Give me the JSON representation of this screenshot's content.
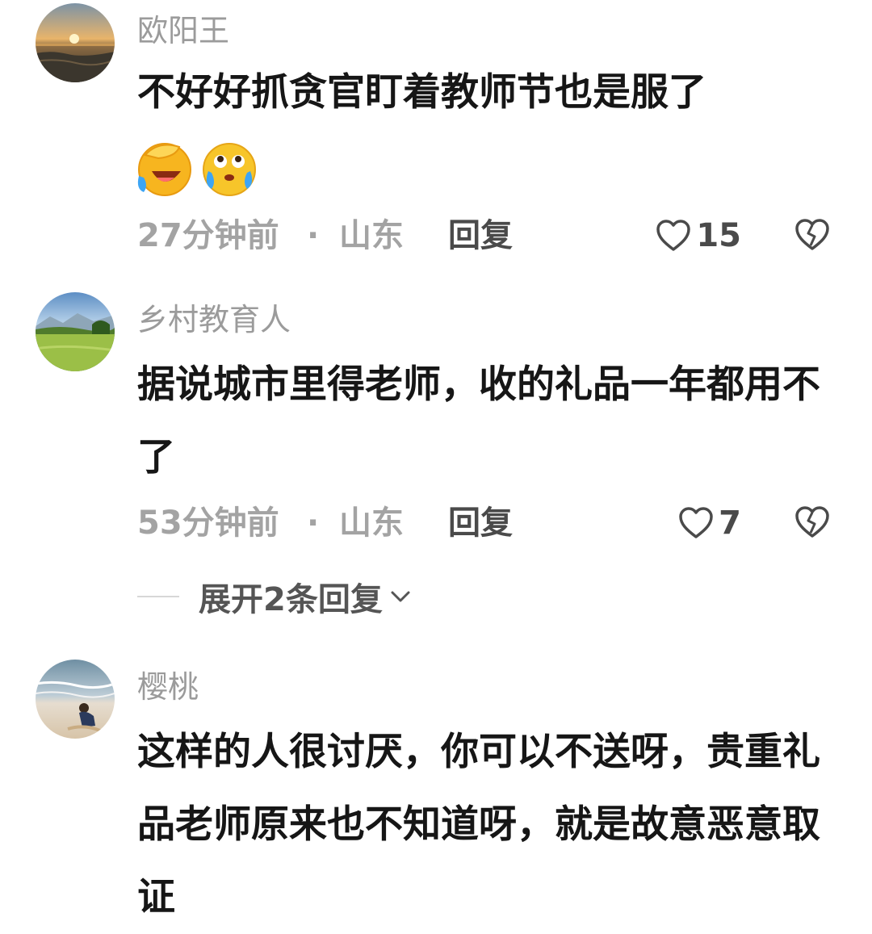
{
  "comments": [
    {
      "username": "欧阳王",
      "text": "不好好抓贪官盯着教师节也是服了",
      "emojis": [
        "cover-face-laugh-cry-emoji",
        "look-up-tears-emoji"
      ],
      "time": "27分钟前",
      "dot": "·",
      "location": "山东",
      "reply_label": "回复",
      "likes": "15",
      "avatar_icon": "sunset-sea-avatar"
    },
    {
      "username": "乡村教育人",
      "text": "据说城市里得老师，收的礼品一年都用不了",
      "time": "53分钟前",
      "dot": "·",
      "location": "山东",
      "reply_label": "回复",
      "likes": "7",
      "avatar_icon": "green-meadow-avatar",
      "expand_label": "展开2条回复"
    },
    {
      "username": "樱桃",
      "text": "这样的人很讨厌，你可以不送呀，贵重礼品老师原来也不知道呀，就是故意恶意取证",
      "avatar_icon": "beach-child-avatar"
    }
  ],
  "icons": {
    "like": "heart-outline-icon",
    "dislike": "broken-heart-icon",
    "expand": "chevron-down-icon"
  },
  "colors": {
    "username": "#9b9b9b",
    "text": "#161616",
    "meta": "#a3a3a3",
    "action": "#4a4a4a"
  }
}
